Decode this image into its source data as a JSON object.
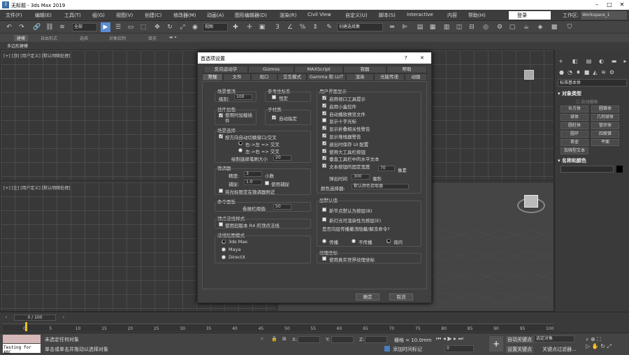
{
  "window": {
    "title": "无标题 - 3ds Max 2019",
    "app_icon": "3"
  },
  "menu": {
    "items": [
      "文件(F)",
      "编辑(E)",
      "工具(T)",
      "组(G)",
      "视图(V)",
      "创建(C)",
      "修改器(M)",
      "动画(A)",
      "图形编辑器(D)",
      "渲染(R)",
      "Civil View",
      "自定义(U)",
      "脚本(S)",
      "Interactive",
      "内容",
      "帮助(H)"
    ],
    "login": "登录",
    "workspace_label": "工作区:",
    "workspace_value": "Workspace_1"
  },
  "toolbar": {
    "filter_select": "全部",
    "view_select": "视图",
    "selection_set": "创建选择集",
    "spinner_value": "3"
  },
  "ribbon": {
    "tabs": [
      "建模",
      "自由形式",
      "选择",
      "对象绘制",
      "填充"
    ]
  },
  "subbar": {
    "label": "多边形建模"
  },
  "viewports": {
    "top_left": "[+] [顶] [用户定义] [默认明暗处理]",
    "bottom_left": "[+] [左] [用户定义] [默认明暗处理]"
  },
  "command_panel": {
    "dropdown": "标准基本体",
    "object_type_header": "对象类型",
    "auto_grid": "自动栅格",
    "objects": [
      "长方体",
      "圆锥体",
      "球体",
      "几何球体",
      "圆柱体",
      "管状体",
      "圆环",
      "四棱锥",
      "茶壶",
      "平面",
      "加强型文本"
    ],
    "name_color_header": "名称和颜色"
  },
  "dialog": {
    "title": "首选项设置",
    "help": "?",
    "close": "✕",
    "tabs_row1": [
      "反向运动学",
      "Gizmos",
      "MAXScript",
      "容器",
      "帮助"
    ],
    "tabs_row2": [
      "常规",
      "文件",
      "视口",
      "交互模式",
      "Gamma 和 LUT",
      "渲染",
      "光能传递",
      "动画"
    ],
    "active_tab": "常规",
    "scene_undo": {
      "header": "场景撤消",
      "level_label": "级别:",
      "level_value": "100"
    },
    "ref_coord": {
      "header": "参考坐标系",
      "constant": "恒定"
    },
    "plugin_loading": {
      "header": "插件加载",
      "load_on_demand": "使用时加载插件"
    },
    "sub_material": {
      "header": "子材质",
      "auto_assign": "自动指定"
    },
    "scene_selection": {
      "header": "场景选择",
      "auto_window_crossing": "按方向自动切换窗口/交叉",
      "right_left": "右->左 => 交叉",
      "left_right": "左->右 => 交叉",
      "paint_brush_label": "绘制选择笔刷大小",
      "paint_brush_value": "20"
    },
    "spinners": {
      "header": "微调器",
      "precision_label": "精度:",
      "precision_value": "3",
      "precision_unit": "小数",
      "snap_label": "捕捉:",
      "snap_value": "1.0",
      "use_snap": "使用捕捉",
      "wrap_cursor": "将光标限定在微调器附近"
    },
    "command_panel": {
      "header": "命令面板",
      "rollout_label": "卷展栏阈值:",
      "rollout_value": "50"
    },
    "vertex_normal": {
      "header": "顶点法线样式",
      "legacy": "使用旧版本 R4 的顶点法线"
    },
    "ui_display": {
      "header": "用户界面显示",
      "items": [
        "启用视口工具提示",
        "启用小盒控件",
        "自动播放预览文件",
        "显示十字光标",
        "显示折叠相关性警告",
        "显示堆栈器警告",
        "退出时保存 UI 配置",
        "使用大工具栏按钮",
        "垂直工具栏中的水平文本",
        "文本按钮的固定宽度"
      ],
      "checked": [
        true,
        true,
        true,
        false,
        true,
        true,
        true,
        true,
        true,
        true
      ],
      "fixed_width_value": "70",
      "fixed_width_unit": "像素",
      "flyout_label": "弹出时间",
      "flyout_value": "300",
      "flyout_unit": "毫秒",
      "color_picker_label": "颜色选择器:",
      "color_picker_value": "默认颜色拾取器"
    },
    "layer_defaults": {
      "header": "层默认值",
      "new_nodes": "新节点默认为按层(B)",
      "new_lights": "新灯光可渲染性为按层(E)",
      "question": "是否向层传播撤消隐藏/解冻命令?",
      "options": [
        "传播",
        "不传播",
        "询问"
      ],
      "selected": "询问"
    },
    "texture_coords": {
      "header": "纹理坐标",
      "real_world": "使用真实世界纹理坐标"
    },
    "ui_mode": {
      "header": "法线贴图模式",
      "options": [
        "3ds Max",
        "Maya",
        "DirectX"
      ],
      "selected": "3ds Max"
    },
    "ok": "确定",
    "cancel": "取消"
  },
  "trackbar": {
    "frame_counter": "0 / 100",
    "ticks": [
      "0",
      "5",
      "10",
      "15",
      "20",
      "25",
      "30",
      "35",
      "40",
      "45",
      "50",
      "55",
      "60",
      "65",
      "70",
      "75",
      "80",
      "85",
      "90",
      "95",
      "100"
    ]
  },
  "status": {
    "maxscript_field": "Testing for ABC",
    "line1": "未选定任何对象",
    "line2": "单击或单击并拖动以选择对象",
    "x_label": "X:",
    "y_label": "Y:",
    "z_label": "Z:",
    "grid_label": "栅格 = 10.0mm",
    "add_time_tag": "添加时间标记",
    "auto_key": "自动关键点",
    "selected_object": "选定对象",
    "set_key": "设置关键点",
    "key_filters": "关键点过滤器...",
    "frame_value": "0"
  }
}
